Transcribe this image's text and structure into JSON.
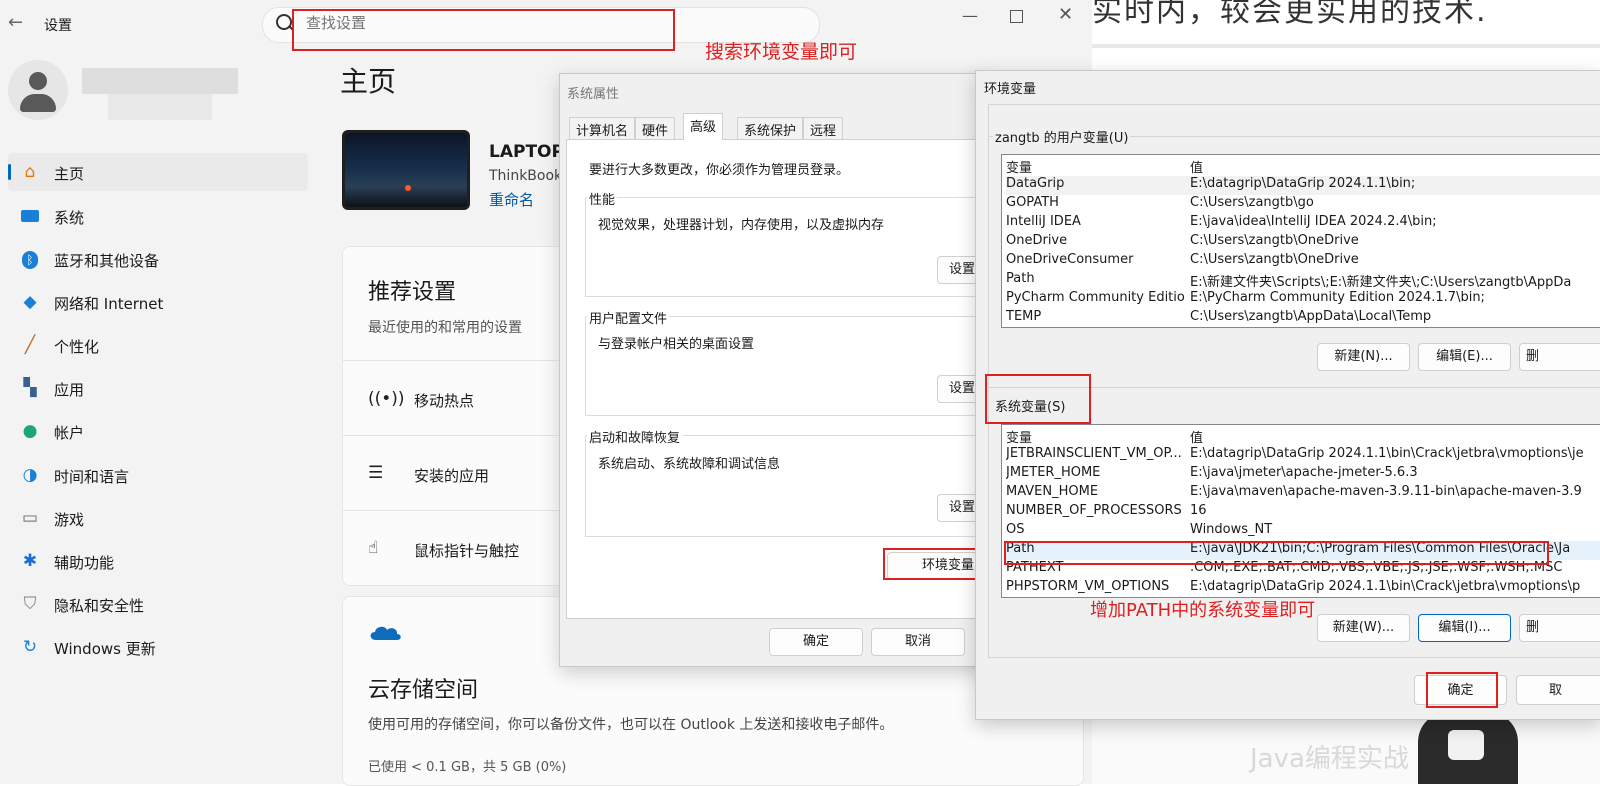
{
  "settings": {
    "title": "设置",
    "search_placeholder": "查找设置",
    "home_title": "主页",
    "nav": [
      {
        "label": "主页",
        "icon": "home-icon"
      },
      {
        "label": "系统",
        "icon": "monitor-icon"
      },
      {
        "label": "蓝牙和其他设备",
        "icon": "bluetooth-icon"
      },
      {
        "label": "网络和 Internet",
        "icon": "wifi-icon"
      },
      {
        "label": "个性化",
        "icon": "brush-icon"
      },
      {
        "label": "应用",
        "icon": "apps-icon"
      },
      {
        "label": "帐户",
        "icon": "person-icon"
      },
      {
        "label": "时间和语言",
        "icon": "globe-clock-icon"
      },
      {
        "label": "游戏",
        "icon": "gamepad-icon"
      },
      {
        "label": "辅助功能",
        "icon": "accessibility-icon"
      },
      {
        "label": "隐私和安全性",
        "icon": "shield-icon"
      },
      {
        "label": "Windows 更新",
        "icon": "update-icon"
      }
    ],
    "device": {
      "name": "LAPTOP",
      "model": "ThinkBook",
      "rename": "重命名"
    },
    "recommended": {
      "title": "推荐设置",
      "subtitle": "最近使用的和常用的设置",
      "items": [
        "移动热点",
        "安装的应用",
        "鼠标指针与触控"
      ]
    },
    "cloud": {
      "title": "云存储空间",
      "desc": "使用可用的存储空间，你可以备份文件，也可以在 Outlook 上发送和接收电子邮件。",
      "usage": "已使用 < 0.1 GB，共 5 GB (0%)"
    }
  },
  "annotations": {
    "search_hint": "搜索环境变量即可",
    "path_hint": "增加PATH中的系统变量即可"
  },
  "sysprops": {
    "title": "系统属性",
    "tabs": [
      "计算机名",
      "硬件",
      "高级",
      "系统保护",
      "远程"
    ],
    "notice": "要进行大多数更改，你必须作为管理员登录。",
    "groups": [
      {
        "label": "性能",
        "desc": "视觉效果，处理器计划，内存使用，以及虚拟内存",
        "button": "设置"
      },
      {
        "label": "用户配置文件",
        "desc": "与登录帐户相关的桌面设置",
        "button": "设置"
      },
      {
        "label": "启动和故障恢复",
        "desc": "系统启动、系统故障和调试信息",
        "button": "设置"
      }
    ],
    "env_button": "环境变量",
    "ok": "确定",
    "cancel": "取消"
  },
  "env": {
    "title": "环境变量",
    "user_section": "zangtb 的用户变量(U)",
    "col_var": "变量",
    "col_val": "值",
    "user_vars": [
      [
        "DataGrip",
        "E:\\datagrip\\DataGrip 2024.1.1\\bin;"
      ],
      [
        "GOPATH",
        "C:\\Users\\zangtb\\go"
      ],
      [
        "IntelliJ IDEA",
        "E:\\java\\idea\\IntelliJ IDEA 2024.2.4\\bin;"
      ],
      [
        "OneDrive",
        "C:\\Users\\zangtb\\OneDrive"
      ],
      [
        "OneDriveConsumer",
        "C:\\Users\\zangtb\\OneDrive"
      ],
      [
        "Path",
        "E:\\新建文件夹\\Scripts\\;E:\\新建文件夹\\;C:\\Users\\zangtb\\AppDa"
      ],
      [
        "PyCharm Community Edition",
        "E:\\PyCharm Community Edition 2024.1.7\\bin;"
      ],
      [
        "TEMP",
        "C:\\Users\\zangtb\\AppData\\Local\\Temp"
      ]
    ],
    "user_buttons": [
      "新建(N)...",
      "编辑(E)...",
      "删"
    ],
    "sys_section": "系统变量(S)",
    "sys_vars": [
      [
        "JETBRAINSCLIENT_VM_OP...",
        "E:\\datagrip\\DataGrip 2024.1.1\\bin\\Crack\\jetbra\\vmoptions\\je"
      ],
      [
        "JMETER_HOME",
        "E:\\java\\jmeter\\apache-jmeter-5.6.3"
      ],
      [
        "MAVEN_HOME",
        "E:\\java\\maven\\apache-maven-3.9.11-bin\\apache-maven-3.9"
      ],
      [
        "NUMBER_OF_PROCESSORS",
        "16"
      ],
      [
        "OS",
        "Windows_NT"
      ],
      [
        "Path",
        "E:\\java\\JDK21\\bin;C:\\Program Files\\Common Files\\Oracle\\Ja"
      ],
      [
        "PATHEXT",
        ".COM;.EXE;.BAT;.CMD;.VBS;.VBE;.JS;.JSE;.WSF;.WSH;.MSC"
      ],
      [
        "PHPSTORM_VM_OPTIONS",
        "E:\\datagrip\\DataGrip 2024.1.1\\bin\\Crack\\jetbra\\vmoptions\\p"
      ]
    ],
    "sys_buttons": [
      "新建(W)...",
      "编辑(I)...",
      "删"
    ],
    "ok": "确定",
    "cancel": "取"
  },
  "background": {
    "top_text": "实时内，较会更实用的技术.",
    "bottom_text": "Java编程实战"
  }
}
